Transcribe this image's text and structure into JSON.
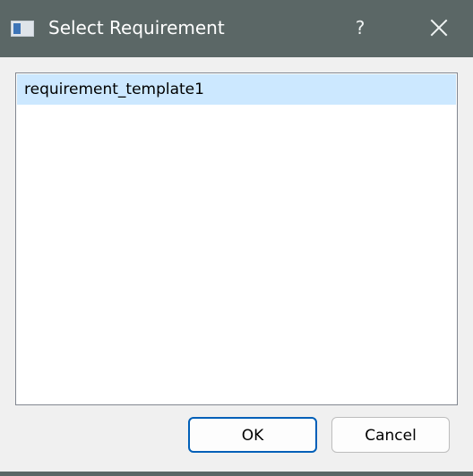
{
  "window": {
    "title": "Select Requirement",
    "help_label": "?",
    "title_icon": "app-window-icon",
    "close_icon": "close-icon"
  },
  "list": {
    "items": [
      {
        "label": "requirement_template1",
        "selected": true
      }
    ]
  },
  "buttons": {
    "ok_label": "OK",
    "cancel_label": "Cancel"
  },
  "colors": {
    "titlebar": "#5b6766",
    "selection": "#cce8ff",
    "focus_border": "#005fb8",
    "dialog_background": "#f0f0f0"
  }
}
